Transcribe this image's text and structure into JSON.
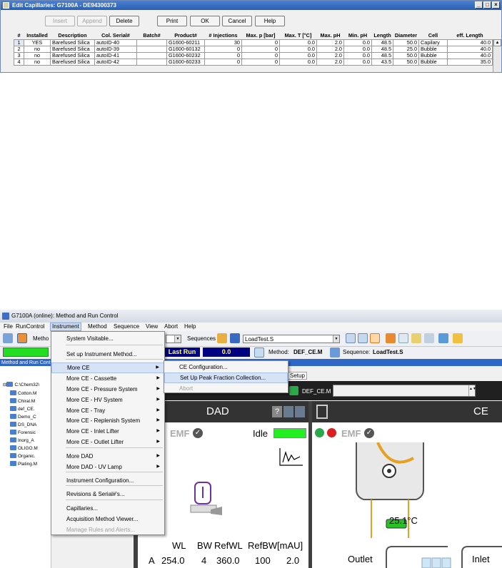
{
  "capdialog": {
    "title": "Edit Capillaries: G7100A - DE94300373",
    "buttons": {
      "insert": "Insert",
      "append": "Append",
      "delete": "Delete",
      "print": "Print",
      "ok": "OK",
      "cancel": "Cancel",
      "help": "Help"
    },
    "columns": [
      "#",
      "Installed",
      "Description",
      "Col. Serial#",
      "Batch#",
      "Product#",
      "# Injections",
      "Max. p [bar]",
      "Max. T [°C]",
      "Max. pH",
      "Min. pH",
      "Length",
      "Diameter",
      "Cell",
      "eff. Length"
    ],
    "rows": [
      [
        "1",
        "YES",
        "Barefused Silica",
        "autoID-40",
        "",
        "G1600-60211",
        "30",
        "0",
        "0.0",
        "2.0",
        "0.0",
        "48.5",
        "50.0",
        "Capilary",
        "40.0"
      ],
      [
        "2",
        "no",
        "Barefused Silica",
        "autoID-39",
        "",
        "G1600-60132",
        "0",
        "0",
        "0.0",
        "2.0",
        "0.0",
        "48.5",
        "25.0",
        "Bubble",
        "40.0"
      ],
      [
        "3",
        "no",
        "Barefused Silica",
        "autoID-41",
        "",
        "G1600-60232",
        "0",
        "0",
        "0.0",
        "2.0",
        "0.0",
        "48.5",
        "50.0",
        "Bubble",
        "40.0"
      ],
      [
        "4",
        "no",
        "Barefused Silica",
        "autoID-42",
        "",
        "G1600-60233",
        "0",
        "0",
        "0.0",
        "2.0",
        "0.0",
        "43.5",
        "50.0",
        "Bubble",
        "35.0"
      ]
    ]
  },
  "window": {
    "title": "G7100A (online): Method and Run Control",
    "menus": [
      "File",
      "RunControl",
      "Instrument",
      "Method",
      "Sequence",
      "View",
      "Abort",
      "Help"
    ],
    "toolbar_method_label": "Metho",
    "sequences_label": "Sequences",
    "sequence_file": "LoadTest.S",
    "last_run": "Last Run",
    "run_value": "0.0",
    "method_label": "Method:",
    "method_value": "DEF_CE.M",
    "sequence_label": "Sequence:",
    "sequence_value": "LoadTest.S",
    "panel_header": "Method and Run Cont",
    "setup_tab": "Setup",
    "current_method": "DEF_CE.M"
  },
  "tree": {
    "root": "C:\\Chem32\\",
    "items": [
      "Cotton.M",
      "Chiral.M",
      "def_CE.",
      "Demo_C",
      "DS_DNA",
      "Forensic",
      "Inorg_A",
      "OLIGO.M",
      "Organic.",
      "Plating.M"
    ]
  },
  "instrument_menu": {
    "items": [
      {
        "label": "System Visitable...",
        "arrow": false,
        "disabled": false
      },
      {
        "label": "Set up Instrument Method...",
        "arrow": false,
        "disabled": false
      },
      {
        "label": "More CE",
        "arrow": true,
        "disabled": false,
        "highlight": true
      },
      {
        "label": "More CE - Cassette",
        "arrow": true,
        "disabled": false
      },
      {
        "label": "More CE - Pressure System",
        "arrow": true,
        "disabled": false
      },
      {
        "label": "More CE - HV System",
        "arrow": true,
        "disabled": false
      },
      {
        "label": "More CE - Tray",
        "arrow": true,
        "disabled": false
      },
      {
        "label": "More CE - Replenish System",
        "arrow": true,
        "disabled": false
      },
      {
        "label": "More CE - Inlet Lifter",
        "arrow": true,
        "disabled": false
      },
      {
        "label": "More CE - Outlet Lifter",
        "arrow": true,
        "disabled": false
      },
      {
        "label": "More DAD",
        "arrow": true,
        "disabled": false
      },
      {
        "label": "More DAD - UV Lamp",
        "arrow": true,
        "disabled": false
      },
      {
        "label": "Instrument Configuration...",
        "arrow": false,
        "disabled": false
      },
      {
        "label": "Revisions & Serial#'s...",
        "arrow": false,
        "disabled": false
      },
      {
        "label": "Capillaries...",
        "arrow": false,
        "disabled": false
      },
      {
        "label": "Acquisition Method Viewer...",
        "arrow": false,
        "disabled": false
      },
      {
        "label": "Manage Rules and Alerts...",
        "arrow": false,
        "disabled": true
      }
    ]
  },
  "submenu": {
    "items": [
      {
        "label": "CE Configuration...",
        "disabled": false
      },
      {
        "label": "Set Up Peak Fraction Collection...",
        "disabled": false,
        "highlight": true
      },
      {
        "label": "Abort",
        "disabled": true
      }
    ]
  },
  "dad": {
    "title": "DAD",
    "emf": "EMF",
    "state": "Idle",
    "state_color": "#22ee22",
    "table_headers": [
      "WL",
      "BW",
      "RefWL",
      "RefBW",
      "[mAU]"
    ],
    "row_label": "A",
    "row_values": [
      "254.0",
      "4",
      "360.0",
      "100",
      "2.0"
    ]
  },
  "ce": {
    "title": "CE",
    "emf": "EMF",
    "temperature": "25.1°C",
    "outlet": "Outlet",
    "inlet": "Inlet"
  },
  "colors": {
    "titlebar": "#2f67c8",
    "navy": "#000080",
    "green": "#22dd22",
    "module_dark": "#333333"
  }
}
